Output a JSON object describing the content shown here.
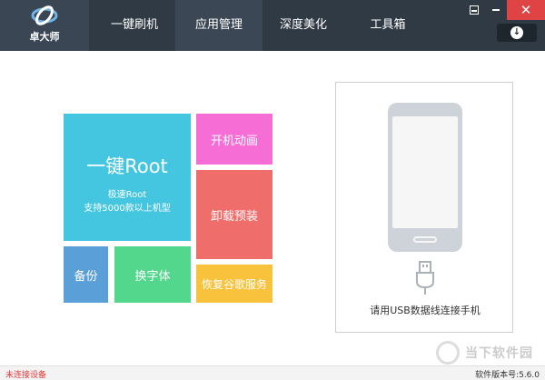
{
  "app": {
    "logo_text": "卓大师"
  },
  "nav": {
    "tabs": [
      "一键刷机",
      "应用管理",
      "深度美化",
      "工具箱"
    ],
    "active": 1
  },
  "window": {
    "min_icon": "minimize-icon",
    "restore_icon": "restore-icon",
    "close_label": "✕",
    "download_icon": "download-icon"
  },
  "tiles": {
    "root": {
      "title": "一键Root",
      "line1": "极速Root",
      "line2": "支持5000款以上机型"
    },
    "boot_animation": "开机动画",
    "uninstall": "卸载预装",
    "backup": "备份",
    "font": "换字体",
    "google": "恢复谷歌服务"
  },
  "phone_panel": {
    "connect_text": "请用USB数据线连接手机",
    "phone_icon": "phone-icon",
    "usb_icon": "usb-icon"
  },
  "watermark": {
    "text": "当下软件园"
  },
  "status": {
    "left": "未连接设备",
    "right": "软件版本号:5.6.0"
  },
  "colors": {
    "header": "#2f3a45",
    "root_tile": "#44c6e1",
    "boot_tile": "#f66dd5",
    "uninstall_tile": "#ef6e6c",
    "backup_tile": "#5b9fd8",
    "font_tile": "#52d78c",
    "google_tile": "#f9c23c",
    "close_button": "#e04343",
    "status_warning": "#e03b3b"
  }
}
